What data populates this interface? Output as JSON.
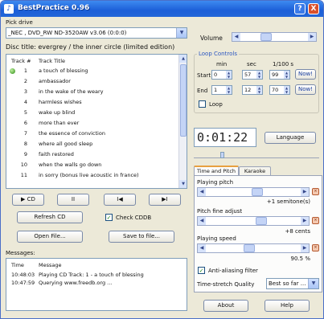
{
  "window": {
    "title": "BestPractice 0.96",
    "help_label": "?",
    "close_label": "X"
  },
  "pick_drive": {
    "label": "Pick drive",
    "value": "_NEC  , DVD_RW ND-3520AW v3.06 (0:0:0)"
  },
  "disc": {
    "title_text": "Disc title:  evergrey / the inner circle (limited edition)"
  },
  "tracks": {
    "col_track": "Track #",
    "col_title": "Track Title",
    "playing_index": 0,
    "rows": [
      {
        "num": "1",
        "title": "a touch of blessing"
      },
      {
        "num": "2",
        "title": "ambassador"
      },
      {
        "num": "3",
        "title": "in the wake of the weary"
      },
      {
        "num": "4",
        "title": "harmless wishes"
      },
      {
        "num": "5",
        "title": "wake up blind"
      },
      {
        "num": "6",
        "title": "more than ever"
      },
      {
        "num": "7",
        "title": "the essence of conviction"
      },
      {
        "num": "8",
        "title": "where all good sleep"
      },
      {
        "num": "9",
        "title": "faith restored"
      },
      {
        "num": "10",
        "title": "when the walls go down"
      },
      {
        "num": "11",
        "title": "in sorry (bonus live acoustic in france)"
      }
    ]
  },
  "transport": {
    "play": "▶ CD",
    "pause": "II",
    "prev": "I◀",
    "next": "▶I"
  },
  "buttons": {
    "refresh_cd": "Refresh CD",
    "check_cddb": "Check CDDB",
    "open_file": "Open File...",
    "save_to_file": "Save to file...",
    "about": "About",
    "help": "Help",
    "language": "Language"
  },
  "messages": {
    "label": "Messages:",
    "col_time": "Time",
    "col_message": "Message",
    "rows": [
      {
        "time": "10:48:03",
        "message": "Playing CD Track: 1 - a touch of blessing"
      },
      {
        "time": "10:47:59",
        "message": "Querying www.freedb.org ..."
      }
    ]
  },
  "volume": {
    "label": "Volume",
    "level": 0.35
  },
  "loop": {
    "group_label": "Loop Controls",
    "col_min": "min",
    "col_sec": "sec",
    "col_hundredths": "1/100 s",
    "start_label": "Start",
    "start": {
      "min": "0",
      "sec": "57",
      "hundredths": "99"
    },
    "end_label": "End",
    "end": {
      "min": "1",
      "sec": "12",
      "hundredths": "70"
    },
    "now_label": "Now!",
    "loop_checkbox_label": "Loop",
    "loop_checked": false
  },
  "position": {
    "time": "0:01:22",
    "level": 0.22
  },
  "tabs": {
    "time_pitch": "Time and Pitch",
    "karaoke": "Karaoke",
    "active": "time_pitch"
  },
  "pitch": {
    "label": "Playing pitch",
    "value_text": "+1 semitone(s)",
    "level": 0.55
  },
  "fine": {
    "label": "Pitch fine adjust",
    "value_text": "+8 cents",
    "level": 0.6
  },
  "speed": {
    "label": "Playing speed",
    "value_text": "90.5 %",
    "level": 0.45
  },
  "antialias": {
    "label": "Anti-aliasing filter",
    "checked": true
  },
  "quality": {
    "label": "Time-stretch Quality",
    "value": "Best so far ..."
  }
}
